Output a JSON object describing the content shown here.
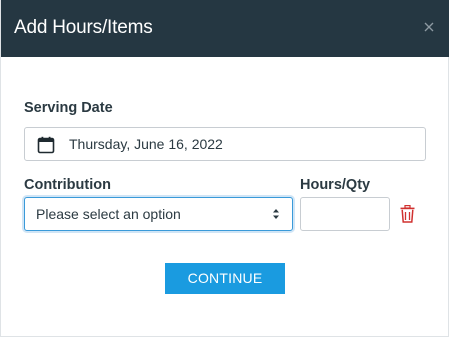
{
  "dialog": {
    "title": "Add Hours/Items",
    "close_icon": "close-icon"
  },
  "serving_date": {
    "label": "Serving Date",
    "value": "Thursday, June 16, 2022",
    "icon": "calendar-icon"
  },
  "contribution": {
    "label": "Contribution",
    "selected": "Please select an option"
  },
  "hours_qty": {
    "label": "Hours/Qty",
    "value": ""
  },
  "delete_icon": "trash-icon",
  "continue_label": "CONTINUE",
  "colors": {
    "header_bg": "#253742",
    "button_bg": "#1a9be0",
    "delete_red": "#d0302f",
    "focus_border": "#3a9ad9"
  }
}
